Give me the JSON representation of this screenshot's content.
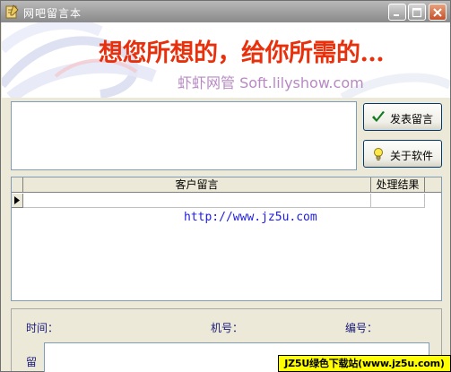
{
  "window": {
    "title": "网吧留言本"
  },
  "banner": {
    "slogan": "想您所想的，给你所需的...",
    "brand": "虾虾网管 Soft.lilyshow.com"
  },
  "compose": {
    "message_value": "",
    "post_button": "发表留言",
    "about_button": "关于软件"
  },
  "grid": {
    "columns": [
      "客户留言",
      "处理结果"
    ],
    "watermark_url": "http://www.jz5u.com"
  },
  "detail": {
    "time_label": "时间：",
    "machine_label": "机号：",
    "number_label": "编号：",
    "message_label": "留"
  },
  "site_watermark": "JZ5U绿色下载站(www.jz5u.com)",
  "colors": {
    "slogan": "#e8300c",
    "brand": "#b888c4",
    "label": "#1a1a7a",
    "watermark_url": "#1c1ce0",
    "site_mark_bg": "#ffff00"
  }
}
